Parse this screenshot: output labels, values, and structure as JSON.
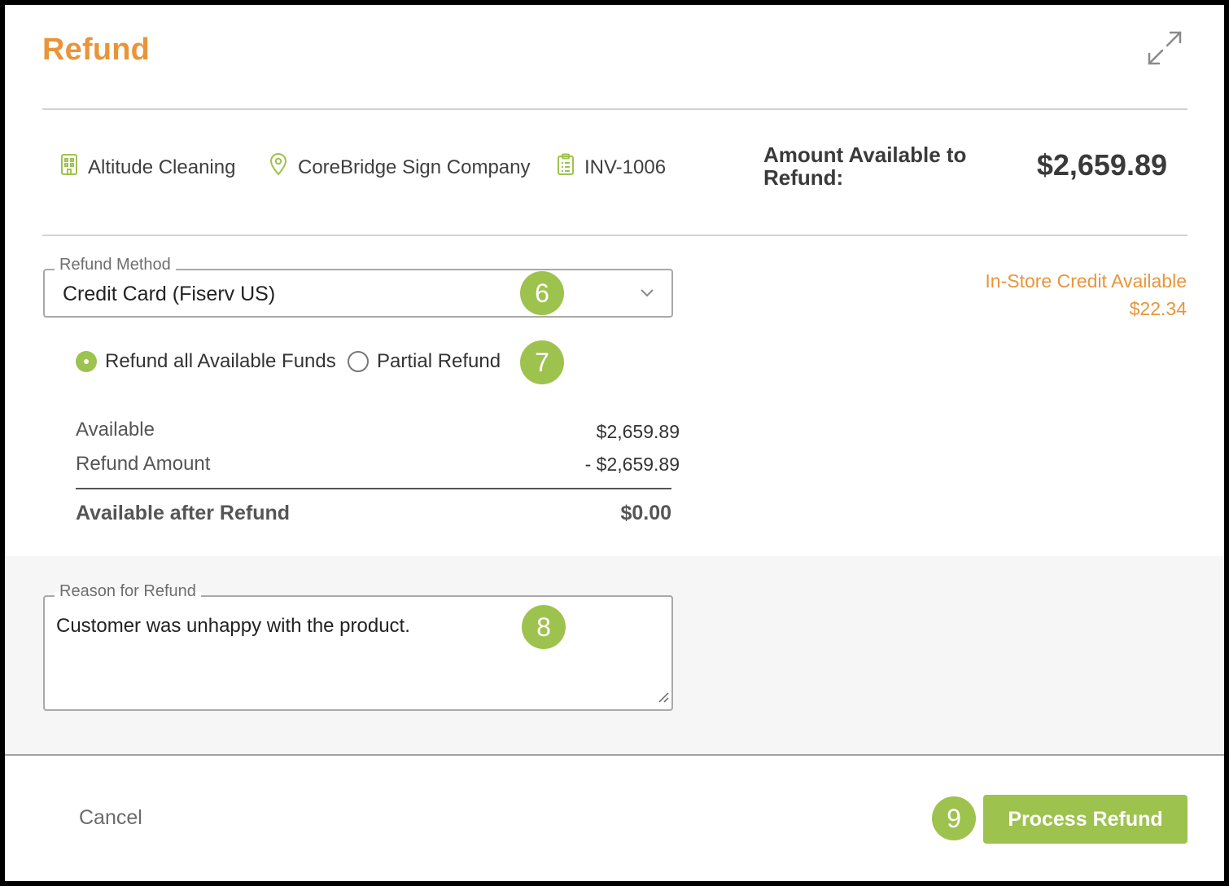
{
  "dialog": {
    "title": "Refund",
    "expand_icon": "expand-arrows-icon"
  },
  "info": {
    "company": {
      "label": "Altitude Cleaning",
      "icon": "building-icon"
    },
    "location": {
      "label": "CoreBridge Sign Company",
      "icon": "location-pin-icon"
    },
    "invoice": {
      "label": "INV-1006",
      "icon": "clipboard-icon"
    },
    "amount_available_label": "Amount Available to Refund:",
    "amount_available_value": "$2,659.89"
  },
  "refund_method": {
    "label": "Refund Method",
    "value": "Credit Card (Fiserv US)",
    "icon": "chevron-down-icon"
  },
  "in_store_credit": {
    "label": "In-Store Credit Available",
    "value": "$22.34"
  },
  "refund_type": {
    "options": [
      {
        "label": "Refund all Available Funds",
        "checked": true
      },
      {
        "label": "Partial Refund",
        "checked": false
      }
    ]
  },
  "summary": {
    "available_label": "Available",
    "available_value": "$2,659.89",
    "refund_amount_label": "Refund Amount",
    "refund_amount_value": "- $2,659.89",
    "after_label": "Available after Refund",
    "after_value": "$0.00"
  },
  "reason": {
    "label": "Reason for Refund",
    "value": "Customer was unhappy with the product."
  },
  "badges": [
    "6",
    "7",
    "8",
    "9"
  ],
  "footer": {
    "cancel_label": "Cancel",
    "process_label": "Process Refund"
  },
  "colors": {
    "accent_orange": "#e8953a",
    "accent_green": "#9ec24e"
  }
}
